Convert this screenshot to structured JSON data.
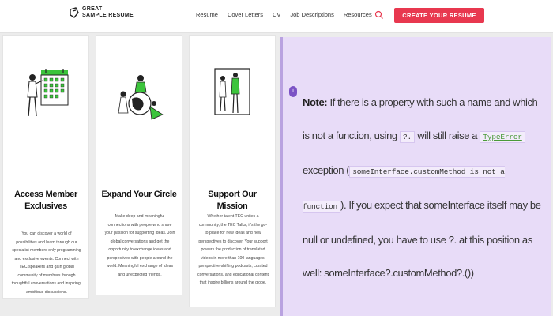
{
  "header": {
    "logo_line1": "GREAT",
    "logo_line2": "SAMPLE RESUME",
    "nav": [
      "Resume",
      "Cover Letters",
      "CV",
      "Job Descriptions",
      "Resources"
    ],
    "cta_label": "CREATE YOUR RESUME"
  },
  "cards": [
    {
      "title": "Access Member Exclusives",
      "text": "You can discover a world of possibilities and learn through our specialist members only programming and exclusive events. Connect with TEC speakers and gain global community of members through thoughtful conversations and inspiring, ambitious discussions."
    },
    {
      "title": "Expand Your Circle",
      "text": "Make deep and meaningful connections with people who share your passion for supporting ideas. Join global conversations and get the opportunity to exchange ideas and perspectives with people around the world. Meaningful exchange of ideas and unexpected friends."
    },
    {
      "title": "Support Our Mission",
      "text": "Whether talent TEC unites a community, the TEC Talks, it's the go-to place for new ideas and new perspectives to discover. Your support powers the production of translated videos in more than 100 languages, perspective-shifting podcasts, curated conversations, and educational content that inspire billions around the globe."
    }
  ],
  "note": {
    "badge": "i",
    "label": "Note:",
    "part1": "If there is a property with such a name and which is not a function, using",
    "code1": "?.",
    "part2": "will still raise a",
    "code2": "TypeError",
    "part3": "exception (",
    "code3": "someInterface.customMethod is not a function",
    "part4": "). If you expect that someInterface itself may be null or undefined, you have to use ?. at this position as well: someInterface?.customMethod?.())"
  },
  "colors": {
    "accent": "#e8384f",
    "note_bg": "#e8dcf8",
    "note_border": "#b9a2e0",
    "illustration_green": "#3cc43c"
  }
}
